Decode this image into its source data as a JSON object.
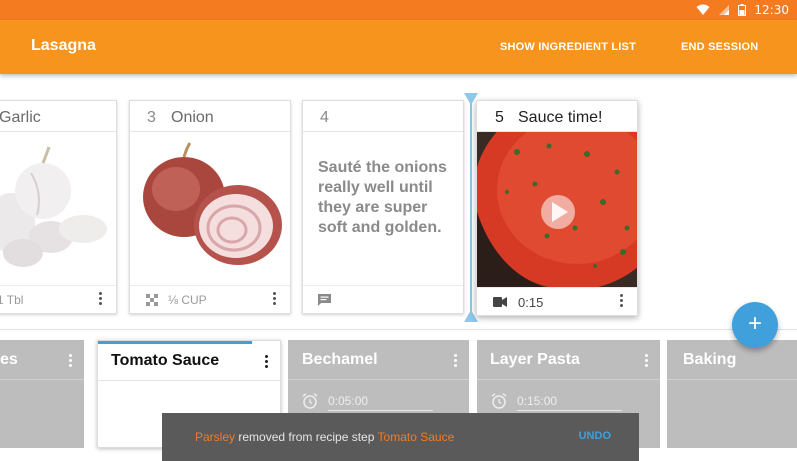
{
  "status_bar": {
    "time": "12:30",
    "icons": [
      "wifi-icon",
      "signal-icon",
      "battery-icon"
    ]
  },
  "app_bar": {
    "title": "Lasagna",
    "actions": [
      "SHOW INGREDIENT LIST",
      "END SESSION"
    ]
  },
  "steps": [
    {
      "number": "",
      "name": "Garlic",
      "quantity": "1 Tbl",
      "image": "garlic"
    },
    {
      "number": "3",
      "name": "Onion",
      "quantity": "⅛ CUP",
      "image": "onion"
    },
    {
      "number": "4",
      "name": "",
      "note": "Sauté the onions really well until they are super soft and golden."
    },
    {
      "number": "5",
      "name": "Sauce time!",
      "quantity": "0:15",
      "image": "sauce-video"
    }
  ],
  "recipes": [
    {
      "name": "es"
    },
    {
      "name": "Tomato Sauce"
    },
    {
      "name": "Bechamel",
      "timer": "0:05:00"
    },
    {
      "name": "Layer Pasta",
      "timer": "0:15:00"
    },
    {
      "name": "Baking"
    }
  ],
  "fab": {
    "label": "+"
  },
  "snackbar": {
    "ingredient": "Parsley",
    "message": " removed from recipe step ",
    "recipe": "Tomato Sauce",
    "action": "UNDO"
  },
  "colors": {
    "status_bar": "#f47b20",
    "app_bar": "#f7941d",
    "accent": "#3fa0dc",
    "recipe_tab": "#bdbdbd",
    "snackbar": "#5a5a5a"
  }
}
